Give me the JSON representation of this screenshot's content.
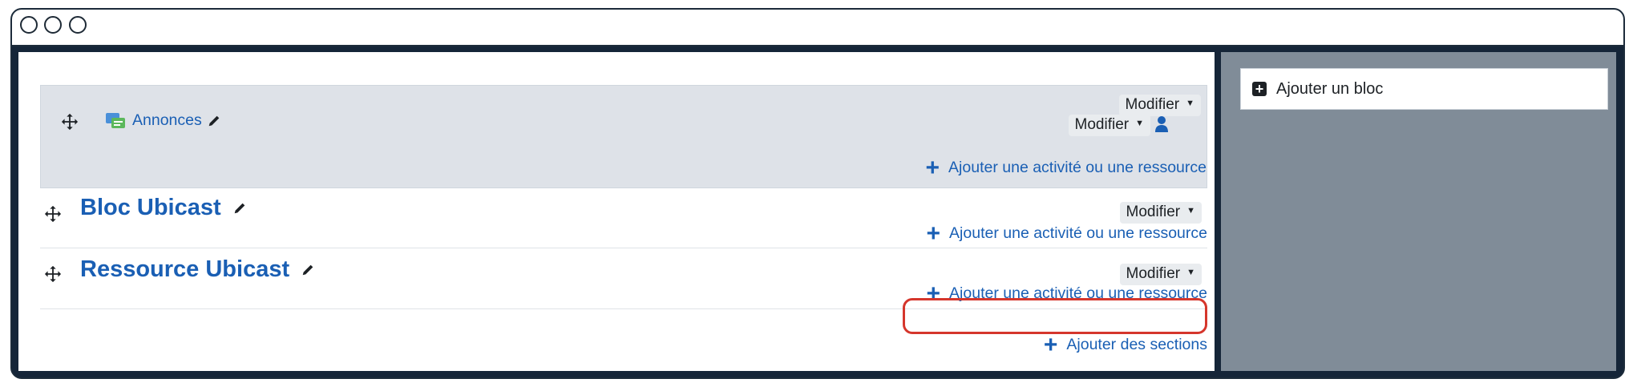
{
  "window": {
    "controls": [
      "close",
      "minimize",
      "maximize"
    ]
  },
  "sections": [
    {
      "activity": {
        "name": "Annonces",
        "icon": "forum-icon"
      },
      "modifier_top": "Modifier",
      "modifier_activity": "Modifier",
      "add_activity": "Ajouter une activité ou une ressource"
    },
    {
      "title": "Bloc Ubicast",
      "modifier": "Modifier",
      "add_activity": "Ajouter une activité ou une ressource"
    },
    {
      "title": "Ressource Ubicast",
      "modifier": "Modifier",
      "add_activity": "Ajouter une activité ou une ressource"
    }
  ],
  "add_sections": "Ajouter des sections",
  "sidebar": {
    "add_block": "Ajouter un bloc"
  },
  "colors": {
    "link": "#1a5fb4",
    "highlight": "#d5362c",
    "sidebar_bg": "#808c98"
  }
}
